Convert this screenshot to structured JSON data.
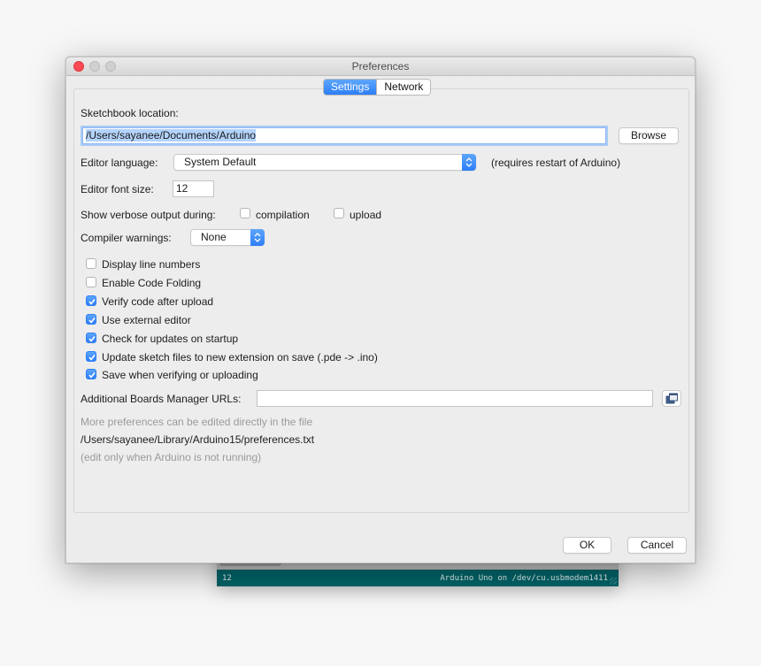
{
  "background_window": {
    "status_line": "12",
    "board_info": "Arduino Uno on /dev/cu.usbmodem1411"
  },
  "dialog": {
    "title": "Preferences",
    "window_controls": [
      "close",
      "minimize",
      "maximize"
    ],
    "tabs": [
      {
        "label": "Settings",
        "active": true
      },
      {
        "label": "Network",
        "active": false
      }
    ],
    "settings": {
      "sketchbook_label": "Sketchbook location:",
      "sketchbook_value": "/Users/sayanee/Documents/Arduino",
      "browse_label": "Browse",
      "editor_language_label": "Editor language:",
      "editor_language_value": "System Default",
      "editor_language_note": "(requires restart of Arduino)",
      "font_size_label": "Editor font size:",
      "font_size_value": "12",
      "verbose_label": "Show verbose output during:",
      "verbose_options": [
        {
          "label": "compilation",
          "checked": false
        },
        {
          "label": "upload",
          "checked": false
        }
      ],
      "compiler_warnings_label": "Compiler warnings:",
      "compiler_warnings_value": "None",
      "checkboxes": [
        {
          "label": "Display line numbers",
          "checked": false
        },
        {
          "label": "Enable Code Folding",
          "checked": false
        },
        {
          "label": "Verify code after upload",
          "checked": true
        },
        {
          "label": "Use external editor",
          "checked": true
        },
        {
          "label": "Check for updates on startup",
          "checked": true
        },
        {
          "label": "Update sketch files to new extension on save (.pde -> .ino)",
          "checked": true
        },
        {
          "label": "Save when verifying or uploading",
          "checked": true
        }
      ],
      "boards_urls_label": "Additional Boards Manager URLs:",
      "boards_urls_value": "",
      "more_prefs_note": "More preferences can be edited directly in the file",
      "prefs_file_path": "/Users/sayanee/Library/Arduino15/preferences.txt",
      "edit_note": "(edit only when Arduino is not running)"
    },
    "buttons": {
      "ok_label": "OK",
      "cancel_label": "Cancel"
    }
  },
  "colors": {
    "accent_blue": "#2d7ef7",
    "status_bar_teal": "#006468",
    "close_red": "#fc4b55"
  }
}
